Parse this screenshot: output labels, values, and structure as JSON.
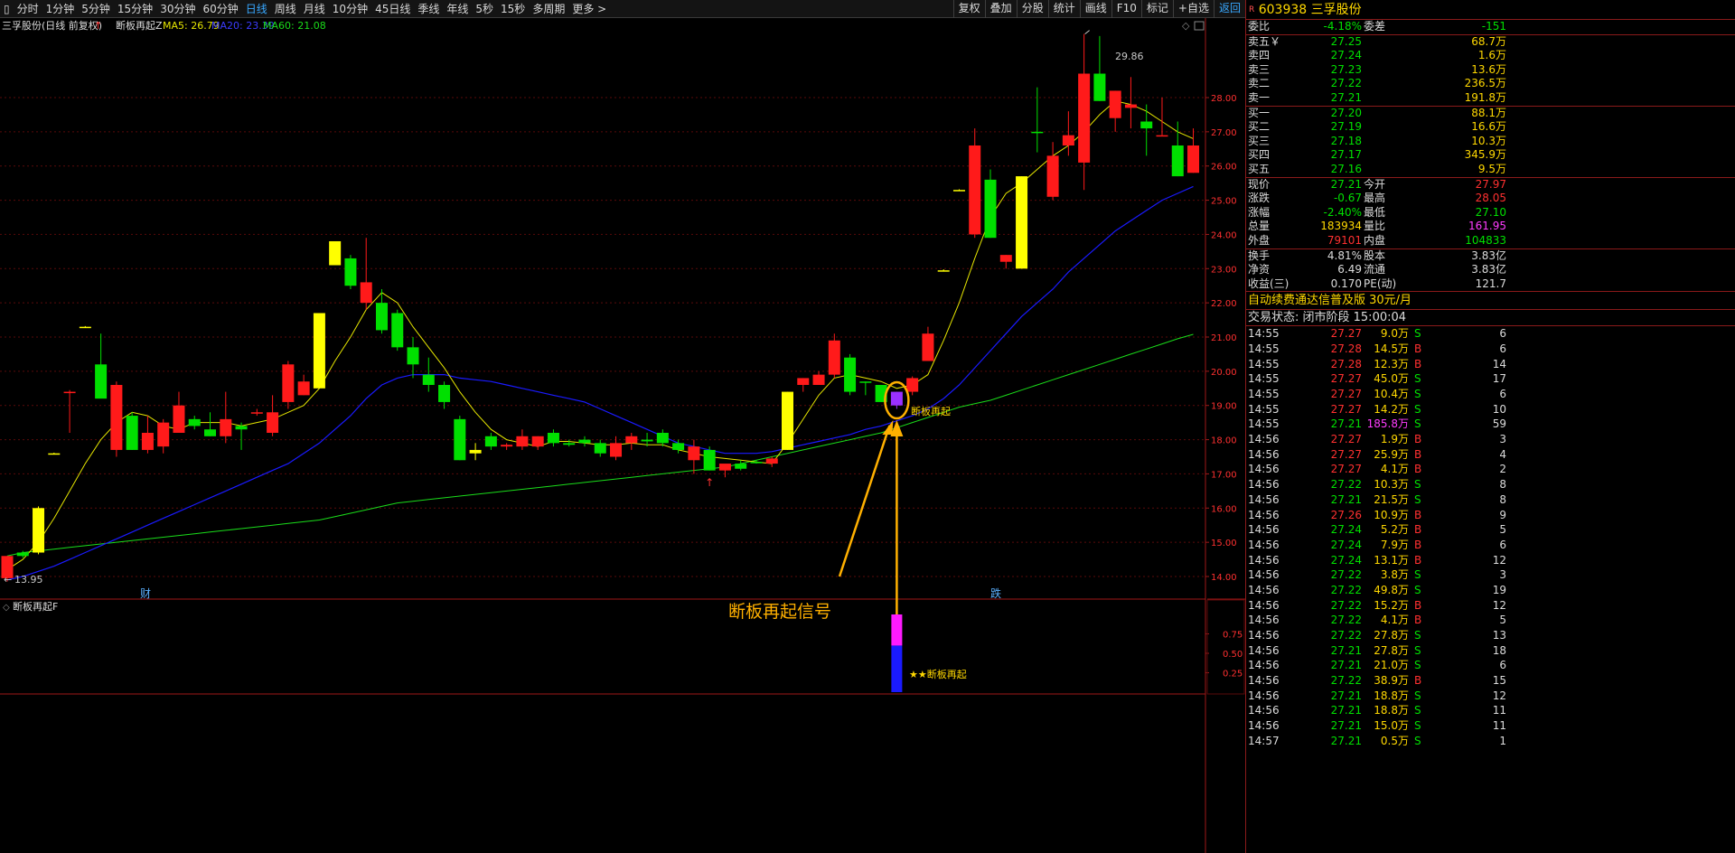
{
  "toolbar": {
    "periods": [
      "分时",
      "1分钟",
      "5分钟",
      "15分钟",
      "30分钟",
      "60分钟",
      "日线",
      "周线",
      "月线",
      "10分钟",
      "45日线",
      "季线",
      "年线",
      "5秒",
      "15秒",
      "多周期",
      "更多 >"
    ],
    "active": "日线",
    "right_buttons": [
      "复权",
      "叠加",
      "分股",
      "统计",
      "画线",
      "F10",
      "标记",
      "+自选",
      "返回"
    ]
  },
  "chart": {
    "legend_stock": "三孚股份(日线 前复权)",
    "legend_indicator": "断板再起Z",
    "ma5": "MA5: 26.79",
    "ma20": "MA20: 23.39",
    "ma60": "MA60: 21.08",
    "price_labels": [
      "28.00",
      "27.00",
      "26.00",
      "25.00",
      "24.00",
      "23.00",
      "22.00",
      "21.00",
      "20.00",
      "19.00",
      "18.00",
      "17.00",
      "16.00",
      "15.00",
      "14.00"
    ],
    "high_label": "29.86",
    "low_label": "13.95",
    "marker_cai": "财",
    "marker_die": "跌",
    "signal_label": "断板再起",
    "signal_title": "断板再起信号",
    "sub_title": "断板再起F",
    "sub_labels": [
      "0.75",
      "0.50",
      "0.25"
    ],
    "sub_signal_label": "★★断板再起",
    "colors": {
      "up": "#ff1a1a",
      "down": "#00e000",
      "yellow": "#ffff00",
      "ma5": "#e6e600",
      "ma20": "#1a1aff",
      "ma60": "#1adc1a",
      "signal": "#ffb000"
    }
  },
  "chart_data": {
    "type": "candlestick",
    "ylim": [
      13.6,
      30.2
    ],
    "candles": [
      {
        "o": 13.95,
        "h": 14.6,
        "l": 13.85,
        "c": 14.6,
        "t": "up"
      },
      {
        "o": 14.6,
        "h": 14.75,
        "l": 14.55,
        "c": 14.7,
        "t": "down"
      },
      {
        "o": 14.7,
        "h": 16.05,
        "l": 14.65,
        "c": 16.0,
        "t": "yellow"
      },
      {
        "o": 17.6,
        "h": 17.62,
        "l": 17.58,
        "c": 17.6,
        "t": "yellow"
      },
      {
        "o": 19.4,
        "h": 19.45,
        "l": 18.2,
        "c": 19.4,
        "t": "up"
      },
      {
        "o": 21.3,
        "h": 21.32,
        "l": 21.28,
        "c": 21.3,
        "t": "yellow"
      },
      {
        "o": 20.2,
        "h": 21.1,
        "l": 19.4,
        "c": 19.2,
        "t": "down"
      },
      {
        "o": 19.6,
        "h": 19.7,
        "l": 17.5,
        "c": 17.7,
        "t": "up"
      },
      {
        "o": 18.7,
        "h": 18.8,
        "l": 17.7,
        "c": 17.7,
        "t": "down"
      },
      {
        "o": 17.7,
        "h": 18.7,
        "l": 17.6,
        "c": 18.2,
        "t": "up"
      },
      {
        "o": 17.8,
        "h": 18.6,
        "l": 17.6,
        "c": 18.5,
        "t": "up"
      },
      {
        "o": 18.2,
        "h": 19.4,
        "l": 18.2,
        "c": 19.0,
        "t": "up"
      },
      {
        "o": 18.6,
        "h": 18.7,
        "l": 18.3,
        "c": 18.4,
        "t": "down"
      },
      {
        "o": 18.3,
        "h": 18.8,
        "l": 18.1,
        "c": 18.1,
        "t": "down"
      },
      {
        "o": 18.1,
        "h": 19.4,
        "l": 17.9,
        "c": 18.6,
        "t": "up"
      },
      {
        "o": 18.4,
        "h": 18.5,
        "l": 17.7,
        "c": 18.3,
        "t": "down"
      },
      {
        "o": 18.8,
        "h": 18.9,
        "l": 18.7,
        "c": 18.8,
        "t": "up"
      },
      {
        "o": 18.2,
        "h": 19.3,
        "l": 18.1,
        "c": 18.8,
        "t": "up"
      },
      {
        "o": 19.1,
        "h": 20.3,
        "l": 18.9,
        "c": 20.2,
        "t": "up"
      },
      {
        "o": 19.3,
        "h": 19.9,
        "l": 19.3,
        "c": 19.7,
        "t": "up"
      },
      {
        "o": 19.5,
        "h": 21.7,
        "l": 19.5,
        "c": 21.7,
        "t": "yellow"
      },
      {
        "o": 23.1,
        "h": 23.8,
        "l": 23.1,
        "c": 23.8,
        "t": "yellow"
      },
      {
        "o": 23.3,
        "h": 23.4,
        "l": 22.4,
        "c": 22.5,
        "t": "down"
      },
      {
        "o": 22.0,
        "h": 23.9,
        "l": 21.8,
        "c": 22.6,
        "t": "up"
      },
      {
        "o": 22.0,
        "h": 22.4,
        "l": 21.1,
        "c": 21.2,
        "t": "down"
      },
      {
        "o": 21.7,
        "h": 21.8,
        "l": 20.6,
        "c": 20.7,
        "t": "down"
      },
      {
        "o": 20.7,
        "h": 21.0,
        "l": 19.8,
        "c": 20.2,
        "t": "down"
      },
      {
        "o": 19.9,
        "h": 20.4,
        "l": 19.4,
        "c": 19.6,
        "t": "down"
      },
      {
        "o": 19.6,
        "h": 19.7,
        "l": 18.9,
        "c": 19.1,
        "t": "down"
      },
      {
        "o": 18.6,
        "h": 18.7,
        "l": 17.4,
        "c": 17.4,
        "t": "down"
      },
      {
        "o": 17.6,
        "h": 17.9,
        "l": 17.4,
        "c": 17.7,
        "t": "yellow"
      },
      {
        "o": 18.1,
        "h": 18.2,
        "l": 17.7,
        "c": 17.8,
        "t": "down"
      },
      {
        "o": 17.8,
        "h": 17.9,
        "l": 17.7,
        "c": 17.85,
        "t": "up"
      },
      {
        "o": 17.8,
        "h": 18.3,
        "l": 17.7,
        "c": 18.1,
        "t": "up"
      },
      {
        "o": 17.8,
        "h": 18.1,
        "l": 17.7,
        "c": 18.1,
        "t": "up"
      },
      {
        "o": 18.2,
        "h": 18.3,
        "l": 17.8,
        "c": 17.9,
        "t": "down"
      },
      {
        "o": 17.9,
        "h": 18.0,
        "l": 17.8,
        "c": 17.85,
        "t": "down"
      },
      {
        "o": 18.0,
        "h": 18.1,
        "l": 17.8,
        "c": 17.9,
        "t": "down"
      },
      {
        "o": 17.9,
        "h": 18.0,
        "l": 17.5,
        "c": 17.6,
        "t": "down"
      },
      {
        "o": 17.5,
        "h": 18.1,
        "l": 17.4,
        "c": 17.9,
        "t": "up"
      },
      {
        "o": 17.9,
        "h": 18.2,
        "l": 17.7,
        "c": 18.1,
        "t": "up"
      },
      {
        "o": 18.0,
        "h": 18.2,
        "l": 17.8,
        "c": 17.95,
        "t": "down"
      },
      {
        "o": 18.2,
        "h": 18.3,
        "l": 17.8,
        "c": 17.9,
        "t": "down"
      },
      {
        "o": 17.9,
        "h": 18.0,
        "l": 17.6,
        "c": 17.7,
        "t": "down"
      },
      {
        "o": 17.4,
        "h": 18.0,
        "l": 17.0,
        "c": 17.8,
        "t": "up"
      },
      {
        "o": 17.7,
        "h": 17.8,
        "l": 17.1,
        "c": 17.1,
        "t": "down"
      },
      {
        "o": 17.1,
        "h": 17.2,
        "l": 16.9,
        "c": 17.3,
        "t": "up"
      },
      {
        "o": 17.3,
        "h": 17.4,
        "l": 17.1,
        "c": 17.15,
        "t": "down"
      },
      {
        "o": 17.35,
        "h": 17.4,
        "l": 17.3,
        "c": 17.35,
        "t": "down"
      },
      {
        "o": 17.3,
        "h": 17.5,
        "l": 17.2,
        "c": 17.45,
        "t": "up"
      },
      {
        "o": 17.7,
        "h": 19.4,
        "l": 17.7,
        "c": 19.4,
        "t": "yellow"
      },
      {
        "o": 19.6,
        "h": 19.8,
        "l": 19.4,
        "c": 19.8,
        "t": "up"
      },
      {
        "o": 19.6,
        "h": 20.0,
        "l": 19.6,
        "c": 19.9,
        "t": "up"
      },
      {
        "o": 19.9,
        "h": 21.1,
        "l": 19.8,
        "c": 20.9,
        "t": "up"
      },
      {
        "o": 20.4,
        "h": 20.5,
        "l": 19.3,
        "c": 19.4,
        "t": "down"
      },
      {
        "o": 19.7,
        "h": 19.7,
        "l": 19.3,
        "c": 19.7,
        "t": "down"
      },
      {
        "o": 19.6,
        "h": 19.6,
        "l": 19.1,
        "c": 19.1,
        "t": "down"
      },
      {
        "o": 19.0,
        "h": 19.4,
        "l": 18.9,
        "c": 19.4,
        "t": "purple"
      },
      {
        "o": 19.4,
        "h": 19.85,
        "l": 19.3,
        "c": 19.8,
        "t": "up"
      },
      {
        "o": 20.3,
        "h": 21.3,
        "l": 20.3,
        "c": 21.1,
        "t": "up"
      },
      {
        "o": 22.95,
        "h": 22.98,
        "l": 22.92,
        "c": 22.95,
        "t": "yellow"
      },
      {
        "o": 25.3,
        "h": 25.32,
        "l": 25.28,
        "c": 25.3,
        "t": "yellow"
      },
      {
        "o": 24.0,
        "h": 27.1,
        "l": 23.9,
        "c": 26.6,
        "t": "up"
      },
      {
        "o": 25.6,
        "h": 25.9,
        "l": 23.9,
        "c": 23.9,
        "t": "down"
      },
      {
        "o": 23.2,
        "h": 23.4,
        "l": 23.0,
        "c": 23.4,
        "t": "up"
      },
      {
        "o": 23.0,
        "h": 25.7,
        "l": 23.0,
        "c": 25.7,
        "t": "yellow"
      },
      {
        "o": 27.0,
        "h": 28.3,
        "l": 26.4,
        "c": 27.0,
        "t": "down"
      },
      {
        "o": 25.1,
        "h": 26.7,
        "l": 25.0,
        "c": 26.3,
        "t": "up"
      },
      {
        "o": 26.6,
        "h": 27.6,
        "l": 26.3,
        "c": 26.9,
        "t": "up"
      },
      {
        "o": 26.1,
        "h": 29.86,
        "l": 25.3,
        "c": 28.7,
        "t": "up"
      },
      {
        "o": 28.7,
        "h": 29.8,
        "l": 27.9,
        "c": 27.9,
        "t": "down"
      },
      {
        "o": 27.4,
        "h": 28.2,
        "l": 27.0,
        "c": 28.2,
        "t": "up"
      },
      {
        "o": 27.7,
        "h": 28.6,
        "l": 27.1,
        "c": 27.8,
        "t": "up"
      },
      {
        "o": 27.3,
        "h": 27.8,
        "l": 26.3,
        "c": 27.1,
        "t": "down"
      },
      {
        "o": 26.9,
        "h": 28.0,
        "l": 26.9,
        "c": 26.9,
        "t": "up"
      },
      {
        "o": 26.6,
        "h": 27.3,
        "l": 25.7,
        "c": 25.7,
        "t": "down"
      },
      {
        "o": 25.8,
        "h": 27.1,
        "l": 25.8,
        "c": 26.6,
        "t": "up"
      }
    ],
    "ma5": [
      14.2,
      14.5,
      15.0,
      15.7,
      16.5,
      17.3,
      18.0,
      18.5,
      18.8,
      18.7,
      18.4,
      18.3,
      18.5,
      18.5,
      18.5,
      18.4,
      18.5,
      18.6,
      18.8,
      19.0,
      19.5,
      20.3,
      21.0,
      21.8,
      22.3,
      22.0,
      21.3,
      20.7,
      20.1,
      19.4,
      18.8,
      18.3,
      18.0,
      17.9,
      17.8,
      17.95,
      17.95,
      17.9,
      17.85,
      17.85,
      17.9,
      17.85,
      17.85,
      17.7,
      17.6,
      17.5,
      17.45,
      17.4,
      17.35,
      17.3,
      17.9,
      18.6,
      19.3,
      19.8,
      19.9,
      19.8,
      19.7,
      19.5,
      19.6,
      19.9,
      20.9,
      22.0,
      23.3,
      24.5,
      25.2,
      25.5,
      25.9,
      26.3,
      26.6,
      27.0,
      27.5,
      27.9,
      27.8,
      27.6,
      27.3,
      27.0,
      26.8
    ],
    "ma20": [
      13.9,
      14.0,
      14.15,
      14.3,
      14.5,
      14.7,
      14.9,
      15.1,
      15.3,
      15.5,
      15.7,
      15.9,
      16.1,
      16.3,
      16.5,
      16.7,
      16.9,
      17.1,
      17.3,
      17.6,
      17.9,
      18.3,
      18.7,
      19.2,
      19.6,
      19.8,
      19.9,
      19.9,
      19.9,
      19.8,
      19.75,
      19.7,
      19.6,
      19.5,
      19.4,
      19.3,
      19.2,
      19.1,
      18.9,
      18.7,
      18.5,
      18.3,
      18.1,
      17.9,
      17.8,
      17.7,
      17.6,
      17.6,
      17.6,
      17.65,
      17.75,
      17.85,
      17.95,
      18.05,
      18.15,
      18.3,
      18.4,
      18.55,
      18.7,
      18.9,
      19.2,
      19.6,
      20.1,
      20.6,
      21.1,
      21.6,
      22.0,
      22.4,
      22.9,
      23.3,
      23.7,
      24.1,
      24.4,
      24.7,
      25.0,
      25.2,
      25.4
    ],
    "ma60": [
      14.6,
      14.7,
      14.75,
      14.8,
      14.85,
      14.9,
      14.95,
      15.0,
      15.05,
      15.1,
      15.15,
      15.2,
      15.25,
      15.3,
      15.35,
      15.4,
      15.45,
      15.5,
      15.55,
      15.6,
      15.65,
      15.75,
      15.85,
      15.95,
      16.05,
      16.15,
      16.2,
      16.25,
      16.3,
      16.35,
      16.4,
      16.45,
      16.5,
      16.55,
      16.6,
      16.65,
      16.7,
      16.75,
      16.8,
      16.85,
      16.9,
      16.95,
      17.0,
      17.05,
      17.1,
      17.15,
      17.2,
      17.3,
      17.4,
      17.5,
      17.6,
      17.7,
      17.8,
      17.9,
      18.0,
      18.1,
      18.2,
      18.35,
      18.5,
      18.65,
      18.8,
      18.95,
      19.05,
      19.15,
      19.3,
      19.45,
      19.6,
      19.75,
      19.9,
      20.05,
      20.2,
      20.35,
      20.5,
      20.65,
      20.8,
      20.95,
      21.08
    ],
    "signal_index": 57,
    "signal_value": 1.0,
    "signal_parts": {
      "magenta": 0.4,
      "blue": 0.6
    }
  },
  "quote": {
    "code": "603938",
    "name": "三孚股份",
    "weibi_label": "委比",
    "weibi": "-4.18%",
    "weicha_label": "委差",
    "weicha": "-151",
    "asks": [
      {
        "label": "卖五￥",
        "price": "27.25",
        "vol": "68.7万"
      },
      {
        "label": "卖四",
        "price": "27.24",
        "vol": "1.6万"
      },
      {
        "label": "卖三",
        "price": "27.23",
        "vol": "13.6万"
      },
      {
        "label": "卖二",
        "price": "27.22",
        "vol": "236.5万"
      },
      {
        "label": "卖一",
        "price": "27.21",
        "vol": "191.8万"
      }
    ],
    "bids": [
      {
        "label": "买一",
        "price": "27.20",
        "vol": "88.1万"
      },
      {
        "label": "买二",
        "price": "27.19",
        "vol": "16.6万"
      },
      {
        "label": "买三",
        "price": "27.18",
        "vol": "10.3万"
      },
      {
        "label": "买四",
        "price": "27.17",
        "vol": "345.9万"
      },
      {
        "label": "买五",
        "price": "27.16",
        "vol": "9.5万"
      }
    ],
    "stats1": [
      {
        "l1": "现价",
        "v1": "27.21",
        "c1": "green",
        "l2": "今开",
        "v2": "27.97",
        "c2": "red"
      },
      {
        "l1": "涨跌",
        "v1": "-0.67",
        "c1": "green",
        "l2": "最高",
        "v2": "28.05",
        "c2": "red"
      },
      {
        "l1": "涨幅",
        "v1": "-2.40%",
        "c1": "green",
        "l2": "最低",
        "v2": "27.10",
        "c2": "green"
      },
      {
        "l1": "总量",
        "v1": "183934",
        "c1": "yellow",
        "l2": "量比",
        "v2": "161.95",
        "c2": "mag"
      },
      {
        "l1": "外盘",
        "v1": "79101",
        "c1": "red",
        "l2": "内盘",
        "v2": "104833",
        "c2": "green"
      }
    ],
    "stats2": [
      {
        "l1": "换手",
        "v1": "4.81%",
        "c1": "white",
        "l2": "股本",
        "v2": "3.83亿",
        "c2": "white"
      },
      {
        "l1": "净资",
        "v1": "6.49",
        "c1": "white",
        "l2": "流通",
        "v2": "3.83亿",
        "c2": "white"
      },
      {
        "l1": "收益(三)",
        "v1": "0.170",
        "c1": "white",
        "l2": "PE(动)",
        "v2": "121.7",
        "c2": "white"
      }
    ],
    "ad": "自动续费通达信普及版  30元/月",
    "status": "交易状态: 闭市阶段 15:00:04",
    "ticks": [
      {
        "t": "14:55",
        "p": "27.27",
        "v": "9.0万",
        "s": "S",
        "n": "6"
      },
      {
        "t": "14:55",
        "p": "27.28",
        "v": "14.5万",
        "s": "B",
        "n": "6"
      },
      {
        "t": "14:55",
        "p": "27.28",
        "v": "12.3万",
        "s": "B",
        "n": "14"
      },
      {
        "t": "14:55",
        "p": "27.27",
        "v": "45.0万",
        "s": "S",
        "n": "17"
      },
      {
        "t": "14:55",
        "p": "27.27",
        "v": "10.4万",
        "s": "S",
        "n": "6"
      },
      {
        "t": "14:55",
        "p": "27.27",
        "v": "14.2万",
        "s": "S",
        "n": "10"
      },
      {
        "t": "14:55",
        "p": "27.21",
        "v": "185.8万",
        "s": "S",
        "n": "59"
      },
      {
        "t": "14:56",
        "p": "27.27",
        "v": "1.9万",
        "s": "B",
        "n": "3"
      },
      {
        "t": "14:56",
        "p": "27.27",
        "v": "25.9万",
        "s": "B",
        "n": "4"
      },
      {
        "t": "14:56",
        "p": "27.27",
        "v": "4.1万",
        "s": "B",
        "n": "2"
      },
      {
        "t": "14:56",
        "p": "27.22",
        "v": "10.3万",
        "s": "S",
        "n": "8"
      },
      {
        "t": "14:56",
        "p": "27.21",
        "v": "21.5万",
        "s": "S",
        "n": "8"
      },
      {
        "t": "14:56",
        "p": "27.26",
        "v": "10.9万",
        "s": "B",
        "n": "9"
      },
      {
        "t": "14:56",
        "p": "27.24",
        "v": "5.2万",
        "s": "B",
        "n": "5"
      },
      {
        "t": "14:56",
        "p": "27.24",
        "v": "7.9万",
        "s": "B",
        "n": "6"
      },
      {
        "t": "14:56",
        "p": "27.24",
        "v": "13.1万",
        "s": "B",
        "n": "12"
      },
      {
        "t": "14:56",
        "p": "27.22",
        "v": "3.8万",
        "s": "S",
        "n": "3"
      },
      {
        "t": "14:56",
        "p": "27.22",
        "v": "49.8万",
        "s": "S",
        "n": "19"
      },
      {
        "t": "14:56",
        "p": "27.22",
        "v": "15.2万",
        "s": "B",
        "n": "12"
      },
      {
        "t": "14:56",
        "p": "27.22",
        "v": "4.1万",
        "s": "B",
        "n": "5"
      },
      {
        "t": "14:56",
        "p": "27.22",
        "v": "27.8万",
        "s": "S",
        "n": "13"
      },
      {
        "t": "14:56",
        "p": "27.21",
        "v": "27.8万",
        "s": "S",
        "n": "18"
      },
      {
        "t": "14:56",
        "p": "27.21",
        "v": "21.0万",
        "s": "S",
        "n": "6"
      },
      {
        "t": "14:56",
        "p": "27.22",
        "v": "38.9万",
        "s": "B",
        "n": "15"
      },
      {
        "t": "14:56",
        "p": "27.21",
        "v": "18.8万",
        "s": "S",
        "n": "12"
      },
      {
        "t": "14:56",
        "p": "27.21",
        "v": "18.8万",
        "s": "S",
        "n": "11"
      },
      {
        "t": "14:56",
        "p": "27.21",
        "v": "15.0万",
        "s": "S",
        "n": "11"
      },
      {
        "t": "14:57",
        "p": "27.21",
        "v": "0.5万",
        "s": "S",
        "n": "1"
      }
    ]
  }
}
